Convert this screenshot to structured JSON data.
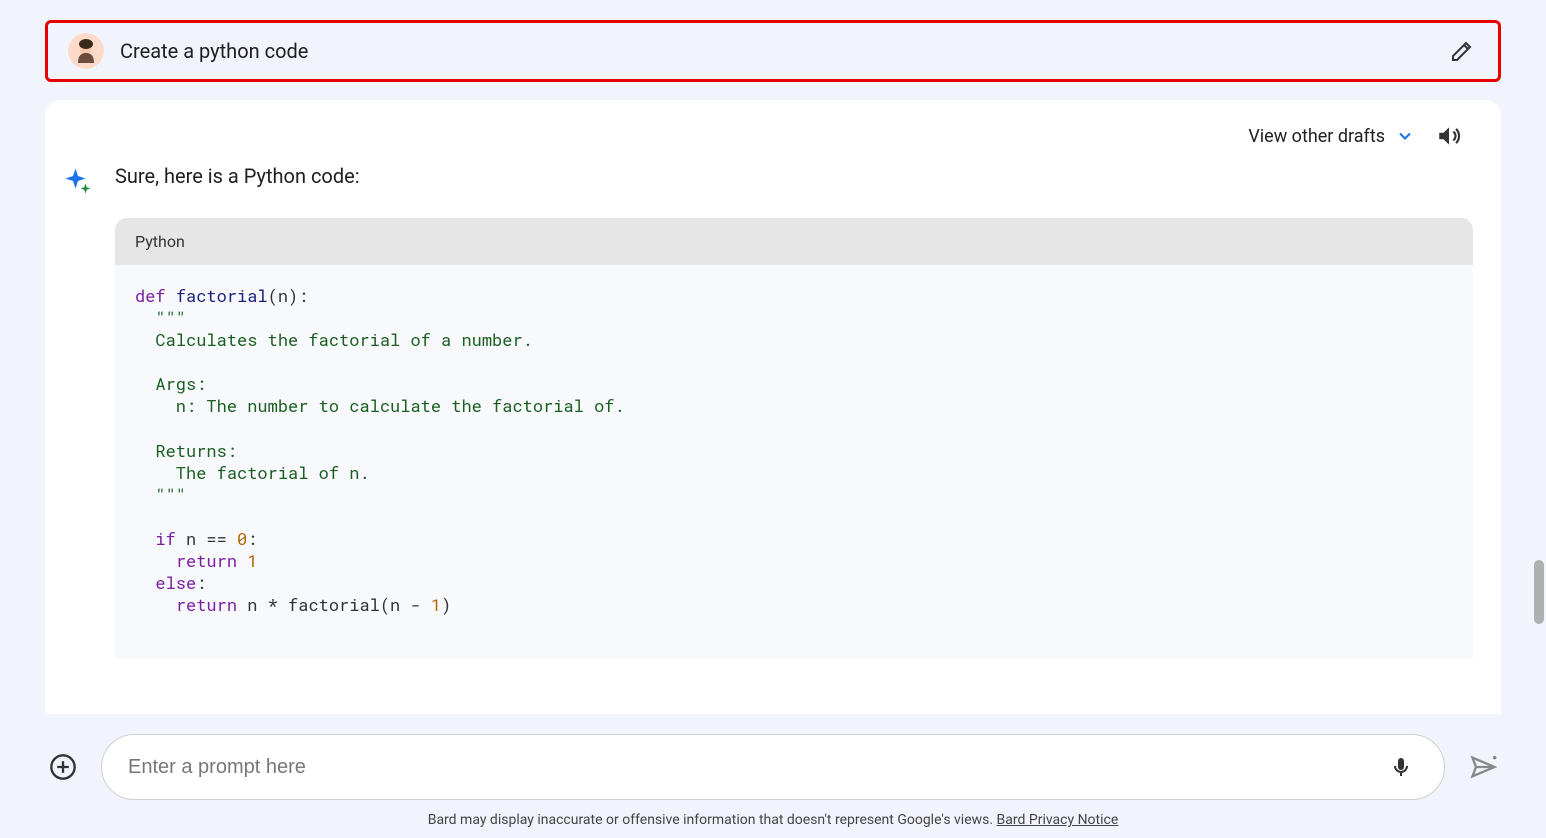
{
  "user": {
    "prompt": "Create a python code"
  },
  "drafts": {
    "label": "View other drafts"
  },
  "response": {
    "intro": "Sure, here is a Python code:",
    "code_lang": "Python",
    "code": {
      "fn_def_kw": "def",
      "fn_name": "factorial",
      "fn_params": "(n):",
      "doc1": "\"\"\"",
      "doc2": "Calculates the factorial of a number.",
      "doc3": "Args:",
      "doc4": "  n: The number to calculate the factorial of.",
      "doc5": "Returns:",
      "doc6": "  The factorial of n.",
      "doc7": "\"\"\"",
      "if_kw": "if",
      "cond": " n == ",
      "zero": "0",
      "colon1": ":",
      "ret1_kw": "return",
      "ret1_val": " 1",
      "else_kw": "else",
      "colon2": ":",
      "ret2_kw": "return",
      "ret2_expr_a": " n * factorial(n - ",
      "ret2_one": "1",
      "ret2_expr_b": ")"
    }
  },
  "input": {
    "placeholder": "Enter a prompt here"
  },
  "footer": {
    "text": "Bard may display inaccurate or offensive information that doesn't represent Google's views. ",
    "link": "Bard Privacy Notice"
  }
}
